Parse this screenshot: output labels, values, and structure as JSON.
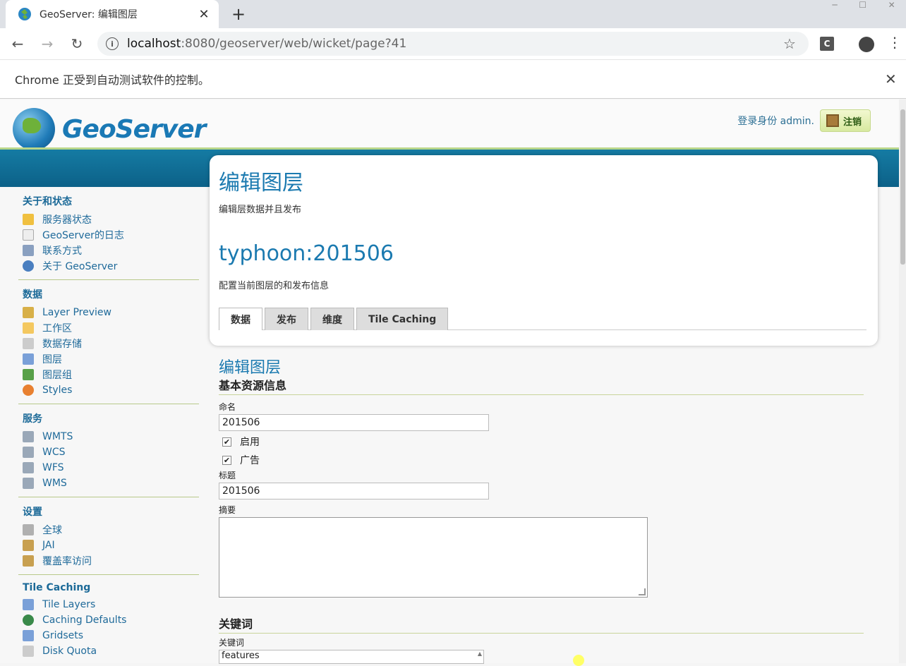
{
  "browser": {
    "tab_title": "GeoServer: 编辑图层",
    "url_host": "localhost",
    "url_path": ":8080/geoserver/web/wicket/page?41",
    "ext_label": "C",
    "infobar_message": "Chrome 正受到自动测试软件的控制。"
  },
  "header": {
    "logo_text": "GeoServer",
    "login_text": "登录身份 admin.",
    "logout_label": "注销"
  },
  "sidebar": {
    "groups": [
      {
        "title": "关于和状态",
        "items": [
          "服务器状态",
          "GeoServer的日志",
          "联系方式",
          "关于 GeoServer"
        ]
      },
      {
        "title": "数据",
        "items": [
          "Layer Preview",
          "工作区",
          "数据存储",
          "图层",
          "图层组",
          "Styles"
        ]
      },
      {
        "title": "服务",
        "items": [
          "WMTS",
          "WCS",
          "WFS",
          "WMS"
        ]
      },
      {
        "title": "设置",
        "items": [
          "全球",
          "JAI",
          "覆盖率访问"
        ]
      },
      {
        "title": "Tile Caching",
        "items": [
          "Tile Layers",
          "Caching Defaults",
          "Gridsets",
          "Disk Quota"
        ]
      }
    ]
  },
  "main": {
    "page_title": "编辑图层",
    "page_subtitle": "编辑层数据并且发布",
    "layer_name": "typhoon:201506",
    "layer_subtitle": "配置当前图层的和发布信息",
    "tabs": [
      "数据",
      "发布",
      "维度",
      "Tile Caching"
    ],
    "active_tab": "数据"
  },
  "form": {
    "title": "编辑图层",
    "section_basic": "基本资源信息",
    "name_label": "命名",
    "name_value": "201506",
    "enabled_label": "启用",
    "advertised_label": "广告",
    "title_label": "标题",
    "title_value": "201506",
    "abstract_label": "摘要",
    "abstract_value": "",
    "section_keywords": "关键词",
    "keywords_label": "关键词",
    "keywords_first": "features"
  }
}
